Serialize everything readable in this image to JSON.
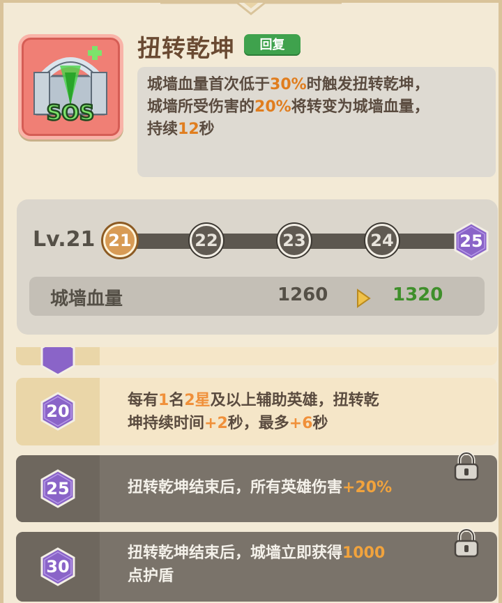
{
  "skill": {
    "title": "扭转乾坤",
    "tag": "回复",
    "icon": "sos-wall-icon",
    "icon_text": "SOS",
    "desc_line1_a": "城墙血量首次低于",
    "desc_line1_b": "30%",
    "desc_line1_c": "时触发扭转乾坤，",
    "desc_line2_a": "城墙所受伤害的",
    "desc_line2_b": "20%",
    "desc_line2_c": "将转变为城墙血量，",
    "desc_line3_a": "持续",
    "desc_line3_b": "12",
    "desc_line3_c": "秒"
  },
  "level": {
    "label": "Lv.21",
    "nodes": [
      "21",
      "22",
      "23",
      "24",
      "25"
    ],
    "current": "21",
    "stat_name": "城墙血量",
    "stat_old": "1260",
    "stat_new": "1320"
  },
  "upgrades": [
    {
      "level": "20",
      "locked": false,
      "line1": [
        "每有",
        "1",
        "名",
        "2星",
        "及以上辅助英雄，扭转乾"
      ],
      "line2": [
        "坤持续时间",
        "+2",
        "秒，最多",
        "+6",
        "秒"
      ]
    },
    {
      "level": "25",
      "locked": true,
      "line1": [
        "扭转乾坤结束后，所有英雄伤害",
        "+20%"
      ]
    },
    {
      "level": "30",
      "locked": true,
      "line1": [
        "扭转乾坤结束后，城墙立即获得",
        "1000"
      ],
      "line2": [
        "点护盾"
      ]
    }
  ],
  "colors": {
    "highlight": "#e07d1e",
    "tag_green": "#3fa24d",
    "stat_new_green": "#3f8f2b",
    "hex_purple": "#8a64c8"
  }
}
